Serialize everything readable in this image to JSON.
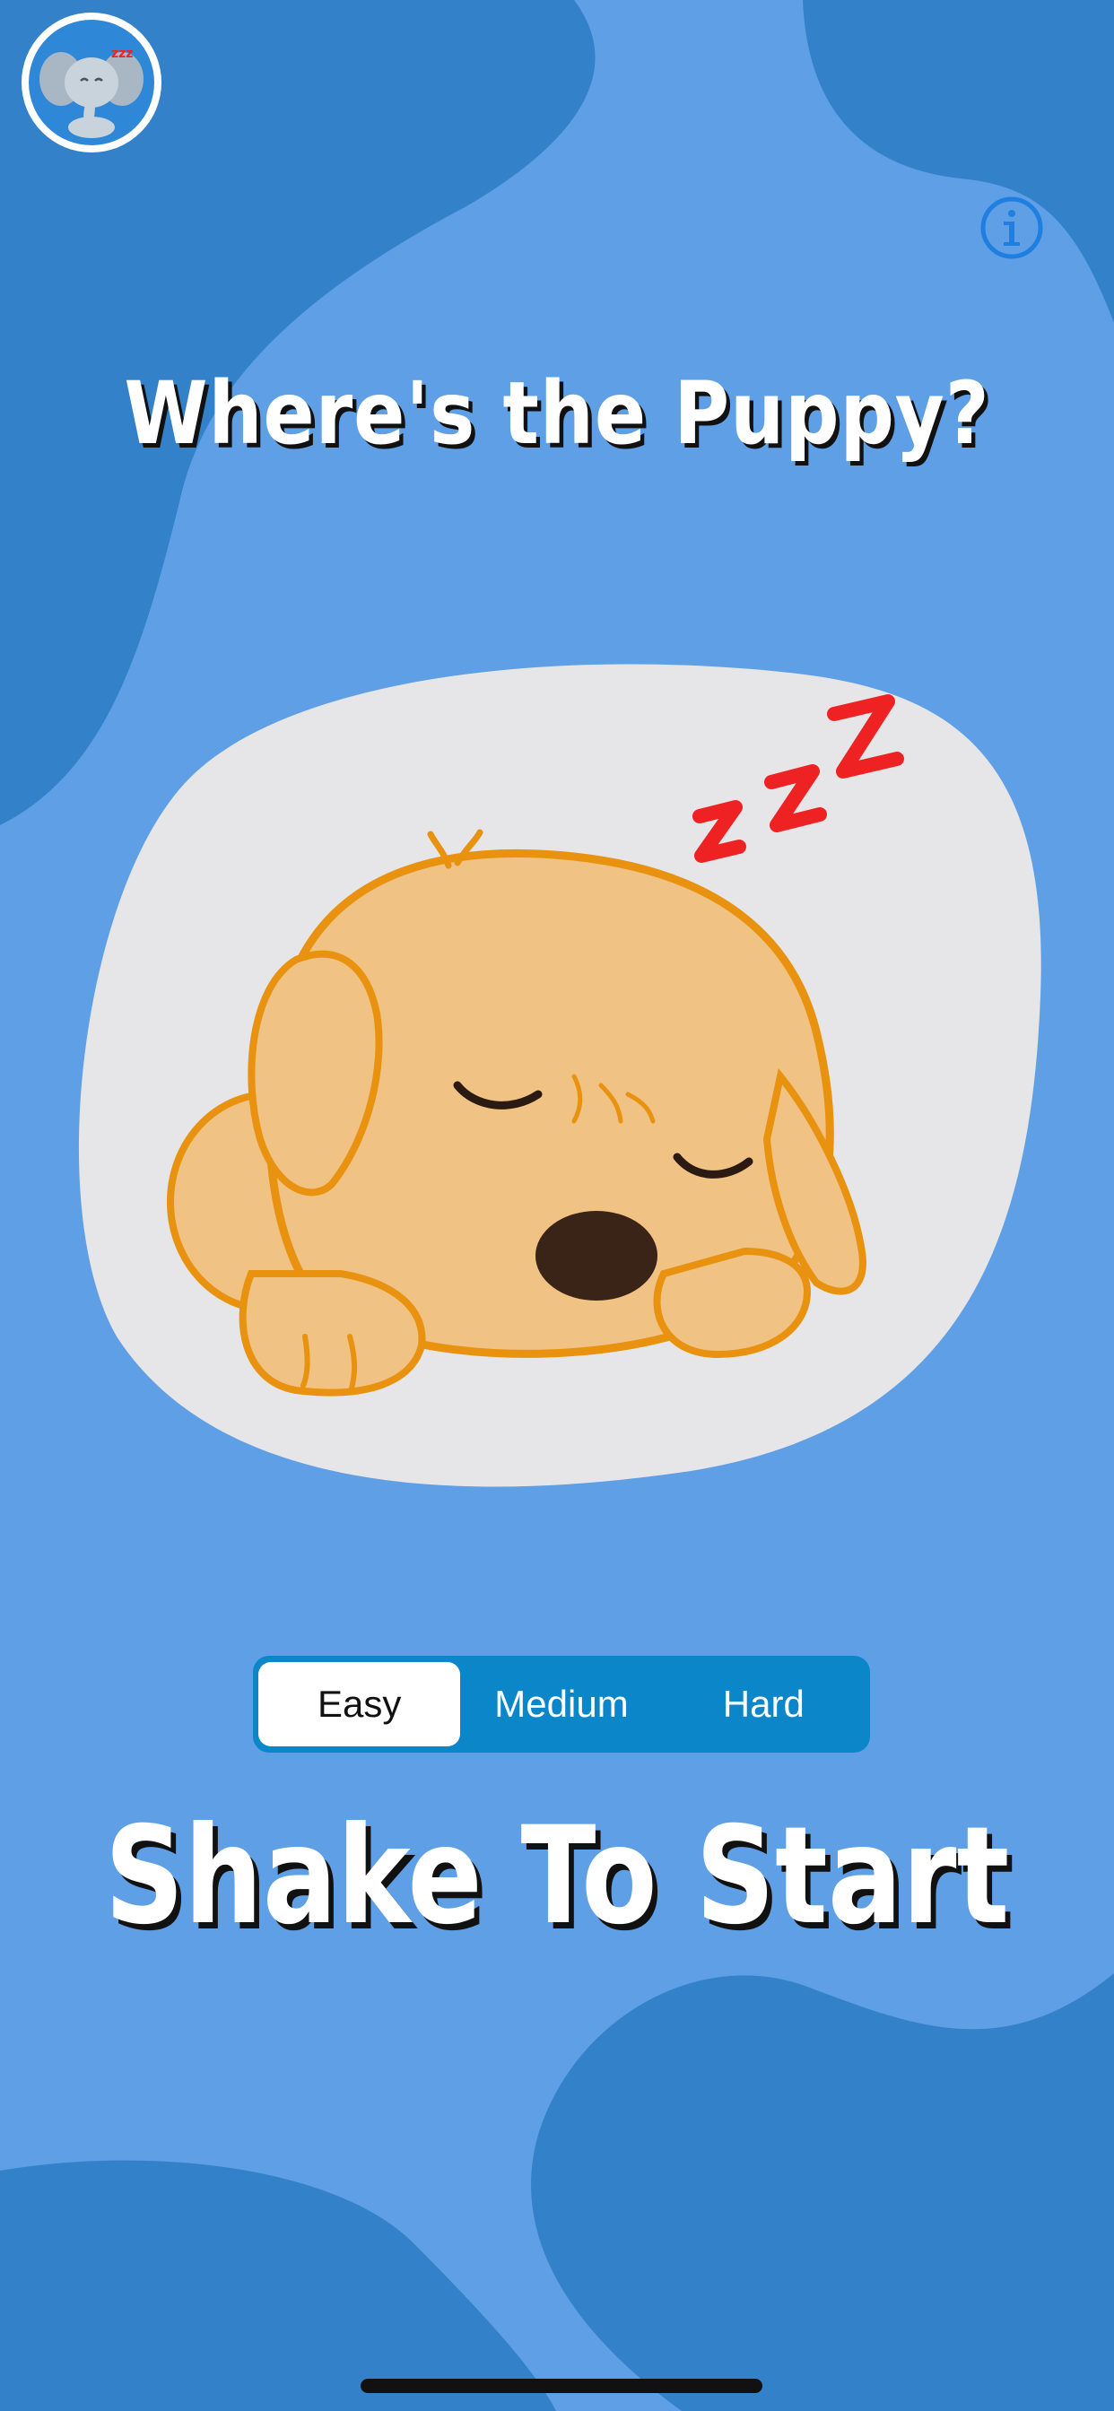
{
  "app": {
    "title": "Where's the Puppy?",
    "logo_icon": "elephant-logo-icon",
    "info_icon": "info-icon"
  },
  "difficulty": {
    "options": [
      "Easy",
      "Medium",
      "Hard"
    ],
    "selected": "Easy"
  },
  "call_to_action": "Shake To Start",
  "illustration": {
    "subject": "sleeping-puppy-icon",
    "zzz": "zzz"
  },
  "colors": {
    "background_light": "#5e9fe6",
    "background_dark": "#3381c9",
    "segment_bg": "#0a86c9",
    "card_bg": "#e6e6e8",
    "zzz_red": "#ee2222",
    "puppy_fur": "#f0c283",
    "puppy_outline": "#e8920f"
  }
}
